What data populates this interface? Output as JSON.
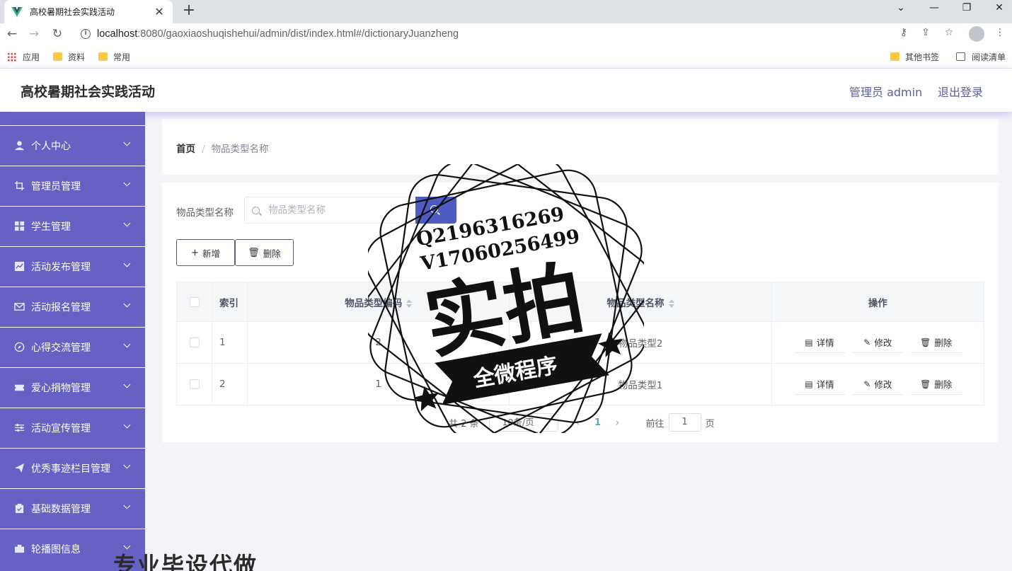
{
  "browser": {
    "tab_title": "高校暑期社会实践活动",
    "tab_close": "✕",
    "new_tab": "+",
    "url_host": "localhost",
    "url_rest": ":8080/gaoxiaoshuqishehui/admin/dist/index.html#/dictionaryJuanzheng",
    "bookmarks": [
      "应用",
      "资料",
      "常用"
    ],
    "other_bookmarks": "其他书签",
    "reading_list": "阅读清单"
  },
  "header": {
    "title": "高校暑期社会实践活动",
    "admin": "管理员 admin",
    "logout": "退出登录"
  },
  "sidebar": {
    "items": [
      {
        "label": "个人中心",
        "icon": "user-icon"
      },
      {
        "label": "管理员管理",
        "icon": "crop-icon"
      },
      {
        "label": "学生管理",
        "icon": "grid-icon"
      },
      {
        "label": "活动发布管理",
        "icon": "chart-icon"
      },
      {
        "label": "活动报名管理",
        "icon": "mail-icon"
      },
      {
        "label": "心得交流管理",
        "icon": "compass-icon"
      },
      {
        "label": "爱心捐物管理",
        "icon": "ticket-icon"
      },
      {
        "label": "活动宣传管理",
        "icon": "sliders-icon"
      },
      {
        "label": "优秀事迹栏目管理",
        "icon": "send-icon"
      },
      {
        "label": "基础数据管理",
        "icon": "clipboard-icon"
      },
      {
        "label": "轮播图信息",
        "icon": "camera-icon"
      }
    ]
  },
  "breadcrumb": {
    "home": "首页",
    "separator": "/",
    "current": "物品类型名称"
  },
  "search": {
    "label": "物品类型名称",
    "placeholder": "物品类型名称"
  },
  "actions": {
    "add": "新增",
    "delete": "删除"
  },
  "table": {
    "columns": [
      "索引",
      "物品类型编码",
      "物品类型名称",
      "操作"
    ],
    "rows": [
      {
        "index": "1",
        "code": "2",
        "name": "物品类型2"
      },
      {
        "index": "2",
        "code": "1",
        "name": "物品类型1"
      }
    ],
    "row_actions": {
      "detail": "详情",
      "edit": "修改",
      "delete": "删除"
    }
  },
  "pagination": {
    "total": "共 2 条",
    "page_size": "10条/页",
    "current_page": "1",
    "goto_label": "前往",
    "goto_value": "1",
    "page_suffix": "页"
  },
  "watermark": {
    "qq": "Q2196316269",
    "vx": "V17060256499",
    "main": "实拍",
    "banner": "全微程序",
    "bottom": "专业毕设代做"
  },
  "colors": {
    "sidebar": "#6761c3",
    "primary": "#4e5bc2",
    "page_active": "#4eb3a5"
  }
}
